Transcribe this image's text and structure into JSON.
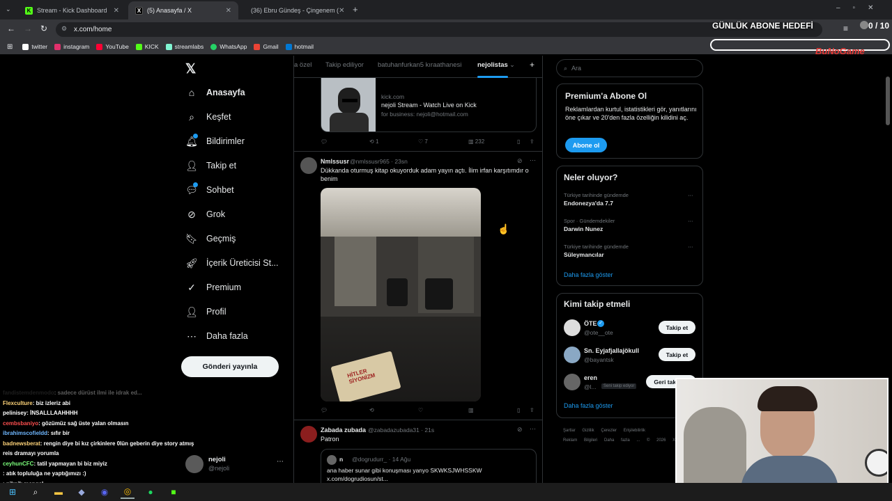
{
  "browser": {
    "tabs": [
      {
        "title": "Stream - Kick Dashboard",
        "favicon": "kick-icon",
        "color": "#53fc18"
      },
      {
        "title": "(5) Anasayfa / X",
        "favicon": "x-icon",
        "color": "#ffffff"
      },
      {
        "title": "(36) Ebru Gündeş - Çingenem (",
        "favicon": "youtube-icon",
        "color": "#ff0033"
      }
    ],
    "url": "x.com/home",
    "bookmarks": [
      {
        "label": "twitter",
        "color": "#ffffff"
      },
      {
        "label": "instagram",
        "color": "#e1306c"
      },
      {
        "label": "YouTube",
        "color": "#ff0033"
      },
      {
        "label": "KICK",
        "color": "#53fc18"
      },
      {
        "label": "streamlabs",
        "color": "#80f5d2"
      },
      {
        "label": "WhatsApp",
        "color": "#25d366"
      },
      {
        "label": "Gmail",
        "color": "#ea4335"
      },
      {
        "label": "hotmail",
        "color": "#0078d4"
      }
    ]
  },
  "overlay": {
    "goal_label": "GÜNLÜK ABONE HEDEFİ",
    "goal_count": "0 / 10",
    "goal_progress": 0
  },
  "nav": {
    "items": [
      {
        "label": "Anasayfa",
        "icon": "home-icon"
      },
      {
        "label": "Keşfet",
        "icon": "search-icon"
      },
      {
        "label": "Bildirimler",
        "icon": "bell-icon"
      },
      {
        "label": "Takip et",
        "icon": "follow-icon"
      },
      {
        "label": "Sohbet",
        "icon": "chat-icon"
      },
      {
        "label": "Grok",
        "icon": "grok-icon"
      },
      {
        "label": "Geçmiş",
        "icon": "bookmark-icon"
      },
      {
        "label": "İçerik Üreticisi St...",
        "icon": "rocket-icon"
      },
      {
        "label": "Premium",
        "icon": "verified-icon"
      },
      {
        "label": "Profil",
        "icon": "profile-icon"
      },
      {
        "label": "Daha fazla",
        "icon": "more-icon"
      }
    ],
    "post_button": "Gönderi yayınla",
    "account": {
      "name": "nejoli",
      "handle": "@nejoli"
    }
  },
  "feed": {
    "tabs": [
      "a özel",
      "Takip ediliyor",
      "batuhanfurkan5 kıraathanesi",
      "nejolistas"
    ],
    "link_card": {
      "domain": "kick.com",
      "title": "nejoli Stream - Watch Live on Kick",
      "desc": "for business: nejoli@hotmail.com"
    },
    "post1_actions": {
      "retweets": "1",
      "likes": "7",
      "views": "232"
    },
    "post2": {
      "name": "Nmlssusr",
      "handle": "@nmlssusr965 · 23sn",
      "text": "Dükkanda oturmuş kitap okuyorduk adam yayın açtı. İlim irfan karşıtımdır o benim",
      "book_title": "HİTLER SİYONİZM"
    },
    "post3": {
      "name": "Zabada zubada",
      "handle": "@zabadazubada31 · 21s",
      "text": "Patron",
      "quote_name": "n",
      "quote_handle": "@dogrudurr_ · 14 Ağu",
      "quote_text1": "ana haber sunar gibi konuşması yanyo SKWKSJWHSSKW",
      "quote_text2": "x.com/dogrudiosun/st..."
    }
  },
  "sidebar": {
    "search_placeholder": "Ara",
    "premium": {
      "title": "Premium'a Abone Ol",
      "text": "Reklamlardan kurtul, istatistikleri gör, yanıtlarını öne çıkar ve 20'den fazla özelliğin kilidini aç.",
      "button": "Abone ol"
    },
    "trends_title": "Neler oluyor?",
    "trends": [
      {
        "context": "Türkiye tarihinde gündemde",
        "name": "Endonezya'da 7.7"
      },
      {
        "context": "Spor · Gündemdekiler",
        "name": "Darwin Nunez"
      },
      {
        "context": "Türkiye tarihinde gündemde",
        "name": "Süleymancılar"
      }
    ],
    "trends_more": "Daha fazla göster",
    "who_title": "Kimi takip etmeli",
    "who": [
      {
        "name": "ÖTE",
        "handle": "@ote__ote",
        "button": "Takip et"
      },
      {
        "name": "Sn. Eyjafjallajökull",
        "handle": "@bayantsk",
        "button": "Takip et"
      },
      {
        "name": "eren",
        "handle": "@l...",
        "badge": "Seni takip ediyor",
        "button": "Geri takip et"
      }
    ],
    "who_more": "Daha fazla göster",
    "footer": [
      "Şartlar",
      "Gizlilik",
      "Çerezler",
      "Erişilebilirlik",
      "Reklam Bilgileri",
      "Daha fazla ...",
      "© 2026 X Corp."
    ]
  },
  "chat": [
    {
      "user": "fandistemdenmodo",
      "msg": ": sadece dürüst ilmi ile idrak ed...",
      "color": "#555555"
    },
    {
      "user": "Flexculture",
      "msg": ": biz izleriz abi",
      "color": "#ffd479"
    },
    {
      "user": "pelinisey",
      "msg": ": İNSALLLAAHHHH",
      "color": "#ffffff"
    },
    {
      "user": "cembsbaniyo",
      "msg": ": gözümüz sağ üste yalan olmasın",
      "color": "#ff4f4f"
    },
    {
      "user": "ibrahimscofieldd",
      "msg": ": sıfır bir",
      "color": "#6fb7ff"
    },
    {
      "user": "badnewsberat",
      "msg": ": rengin diye bi kız çirkinlere 0lün geberin diye story atmış",
      "color": "#ffd479"
    },
    {
      "user": "",
      "msg": "reis dramayı yorumla",
      "color": "#ffffff"
    },
    {
      "user": "ceyhunCFC",
      "msg": ": tatil yapmayan bi biz miyiz",
      "color": "#7cff7c"
    },
    {
      "user": "",
      "msg": ": atık topluluğa ne yaptığımızı :)",
      "color": "#ff4f4f"
    },
    {
      "user": "",
      "msg": ": piknik mangal",
      "color": "#ff4f4f"
    }
  ]
}
